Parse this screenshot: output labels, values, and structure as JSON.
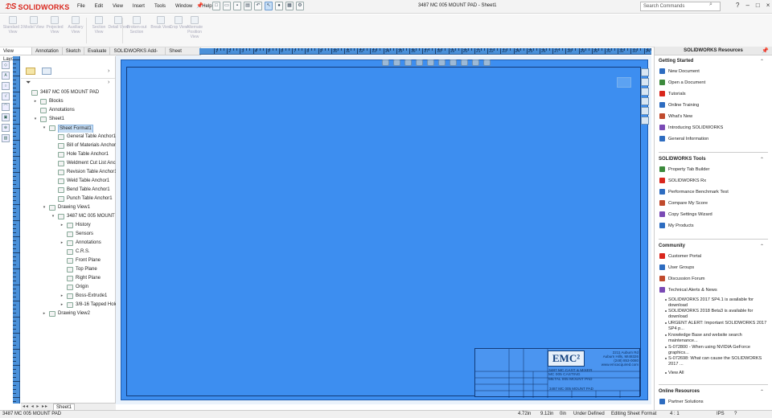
{
  "app": {
    "name": "SOLIDWORKS"
  },
  "menu": [
    "File",
    "Edit",
    "View",
    "Insert",
    "Tools",
    "Window",
    "Help"
  ],
  "document_title": "3487 MC 005 MOUNT PAD - Sheet1",
  "search": {
    "placeholder": "Search Commands"
  },
  "command_manager": [
    {
      "label": "Standard 3 View"
    },
    {
      "label": "Model View"
    },
    {
      "label": "Projected View"
    },
    {
      "label": "Auxiliary View"
    },
    {
      "label": "Section View"
    },
    {
      "label": "Detail View"
    },
    {
      "label": "Broken-out Section"
    },
    {
      "label": "Break View"
    },
    {
      "label": "Crop View"
    },
    {
      "label": "Alternate Position View"
    }
  ],
  "tabs": [
    "View Layout",
    "Annotation",
    "Sketch",
    "Evaluate",
    "SOLIDWORKS Add-Ins",
    "Sheet Format"
  ],
  "ruler_top": [
    "1",
    "2",
    "3",
    "4",
    "5",
    "6",
    "7",
    "8",
    "9",
    "10",
    "11",
    "12",
    "13",
    "14",
    "15",
    "16",
    "17",
    "18",
    "19",
    "20",
    "21",
    "22",
    "23",
    "24",
    "25",
    "26",
    "27",
    "28",
    "29",
    "30",
    "31",
    "32",
    "33",
    "34"
  ],
  "feature_tree": [
    {
      "label": "3487 MC 005 MOUNT PAD",
      "level": 0,
      "expander": ""
    },
    {
      "label": "Blocks",
      "level": 1,
      "expander": "▸"
    },
    {
      "label": "Annotations",
      "level": 1,
      "expander": ""
    },
    {
      "label": "Sheet1",
      "level": 1,
      "expander": "▾"
    },
    {
      "label": "Sheet Format1",
      "level": 2,
      "expander": "▾",
      "selected": true
    },
    {
      "label": "General Table Anchor1",
      "level": 3,
      "expander": ""
    },
    {
      "label": "Bill of Materials Anchor1",
      "level": 3,
      "expander": ""
    },
    {
      "label": "Hole Table Anchor1",
      "level": 3,
      "expander": ""
    },
    {
      "label": "Weldment Cut List Anchor1",
      "level": 3,
      "expander": ""
    },
    {
      "label": "Revision Table Anchor1",
      "level": 3,
      "expander": ""
    },
    {
      "label": "Weld Table Anchor1",
      "level": 3,
      "expander": ""
    },
    {
      "label": "Bend Table Anchor1",
      "level": 3,
      "expander": ""
    },
    {
      "label": "Punch Table Anchor1",
      "level": 3,
      "expander": ""
    },
    {
      "label": "Drawing View1",
      "level": 2,
      "expander": "▾"
    },
    {
      "label": "3487 MC 005 MOUNT PAD",
      "level": 3,
      "expander": "▾"
    },
    {
      "label": "History",
      "level": 4,
      "expander": "▸"
    },
    {
      "label": "Sensors",
      "level": 4,
      "expander": ""
    },
    {
      "label": "Annotations",
      "level": 4,
      "expander": "▸"
    },
    {
      "label": "C.R.S.",
      "level": 4,
      "expander": ""
    },
    {
      "label": "Front Plane",
      "level": 4,
      "expander": ""
    },
    {
      "label": "Top Plane",
      "level": 4,
      "expander": ""
    },
    {
      "label": "Right Plane",
      "level": 4,
      "expander": ""
    },
    {
      "label": "Origin",
      "level": 4,
      "expander": ""
    },
    {
      "label": "Boss-Extrude1",
      "level": 4,
      "expander": "▸"
    },
    {
      "label": "3/8-16 Tapped Hole1",
      "level": 4,
      "expander": "▸"
    },
    {
      "label": "Drawing View2",
      "level": 2,
      "expander": "▸"
    }
  ],
  "sheet_tab": "Sheet1",
  "title_block": {
    "logo": "EMC²",
    "address": [
      "2211 Auburn Rd",
      "Auburn Hills, MI48326",
      "(248) 853-0080",
      "www.emcacquired.com"
    ],
    "description": [
      "3487 MC CAST & MIXER",
      "MC 005 CASTING",
      "METAL 005 MOUNT PAD"
    ],
    "dwg_no": "3487 MC 005 MOUNT PAD"
  },
  "resources_panel": {
    "title": "SOLIDWORKS Resources",
    "sections": [
      {
        "title": "Getting Started",
        "items": [
          "New Document",
          "Open a Document",
          "Tutorials",
          "Online Training",
          "What's New",
          "Introducing SOLIDWORKS",
          "General Information"
        ]
      },
      {
        "title": "SOLIDWORKS Tools",
        "items": [
          "Property Tab Builder",
          "SOLIDWORKS Rx",
          "Performance Benchmark Test",
          "Compare My Score",
          "Copy Settings Wizard",
          "My Products"
        ]
      },
      {
        "title": "Community",
        "items": [
          "Customer Portal",
          "User Groups",
          "Discussion Forum",
          "Technical Alerts & News"
        ]
      },
      {
        "title": "Online Resources",
        "items": [
          "Partner Solutions"
        ]
      }
    ],
    "news": [
      "SOLIDWORKS 2017 SP4.1 is available for download",
      "SOLIDWORKS 2018 Beta3 is available for download",
      "URGENT ALERT: Important SOLIDWORKS 2017 SP4 p...",
      "Knowledge Base and website search maintenance...",
      "S-072800 - When using NVIDIA GeForce graphics...",
      "S-072698: What can cause the SOLIDWORKS 2017 ..."
    ],
    "view_all": "View All"
  },
  "statusbar": {
    "doc": "3487 MC 005 MOUNT PAD",
    "x": "4.72in",
    "y": "9.12in",
    "z": "0in",
    "state": "Under Defined",
    "mode": "Editing Sheet Format",
    "scale": "4 : 1",
    "units": "IPS"
  },
  "colors": {
    "sheet": "#3d8ef0",
    "brand_red": "#d9261c"
  }
}
